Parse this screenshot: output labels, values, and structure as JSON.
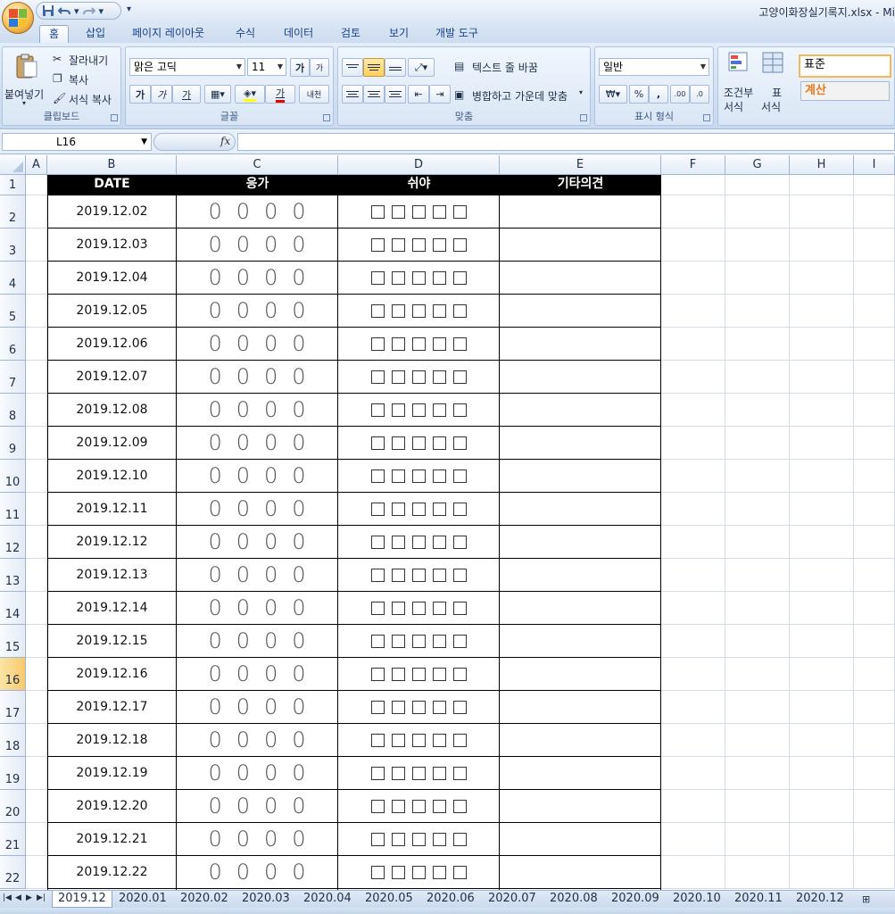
{
  "app": {
    "window_title": "고양이화장실기록지.xlsx - Mi",
    "qat": {
      "save_icon": "save-icon",
      "undo_icon": "undo-icon",
      "redo_icon": "redo-icon"
    },
    "tabs": [
      "홈",
      "삽입",
      "페이지 레이아웃",
      "수식",
      "데이터",
      "검토",
      "보기",
      "개발 도구"
    ]
  },
  "ribbon": {
    "clipboard": {
      "paste": "붙여넣기",
      "cut": "잘라내기",
      "copy": "복사",
      "format_painter": "서식 복사",
      "label": "클립보드"
    },
    "font": {
      "name": "맑은 고딕",
      "size": "11",
      "grow": "가",
      "shrink": "가",
      "bold": "가",
      "italic": "가",
      "underline": "가",
      "font_color": "가",
      "phonetic": "내천",
      "label": "글꼴"
    },
    "alignment": {
      "wrap": "텍스트 줄 바꿈",
      "merge": "병합하고 가운데 맞춤",
      "label": "맞춤"
    },
    "number": {
      "format": "일반",
      "currency": "₩",
      "percent": "%",
      "comma": ",",
      "label": "표시 형식"
    },
    "styles": {
      "cond": "조건부",
      "cond2": "서식",
      "table": "표",
      "table2": "서식",
      "style_normal": "표준",
      "style_calc": "계산"
    }
  },
  "formula_bar": {
    "name_box": "L16",
    "fx": "fx",
    "value": ""
  },
  "columns": [
    "A",
    "B",
    "C",
    "D",
    "E",
    "F",
    "G",
    "H",
    "I"
  ],
  "row_numbers": [
    "1",
    "2",
    "3",
    "4",
    "5",
    "6",
    "7",
    "8",
    "9",
    "10",
    "11",
    "12",
    "13",
    "14",
    "15",
    "16",
    "17",
    "18",
    "19",
    "20",
    "21",
    "22"
  ],
  "selected_row": "16",
  "sheet": {
    "headers": [
      "DATE",
      "응가",
      "쉬야",
      "기타의견"
    ],
    "zero_mark": "0",
    "rows": [
      "2019.12.02",
      "2019.12.03",
      "2019.12.04",
      "2019.12.05",
      "2019.12.06",
      "2019.12.07",
      "2019.12.08",
      "2019.12.09",
      "2019.12.10",
      "2019.12.11",
      "2019.12.12",
      "2019.12.13",
      "2019.12.14",
      "2019.12.15",
      "2019.12.16",
      "2019.12.17",
      "2019.12.18",
      "2019.12.19",
      "2019.12.20",
      "2019.12.21",
      "2019.12.22"
    ]
  },
  "sheet_tabs": [
    "2019.12",
    "2020.01",
    "2020.02",
    "2020.03",
    "2020.04",
    "2020.05",
    "2020.06",
    "2020.07",
    "2020.08",
    "2020.09",
    "2020.10",
    "2020.11",
    "2020.12"
  ],
  "active_sheet": "2019.12"
}
